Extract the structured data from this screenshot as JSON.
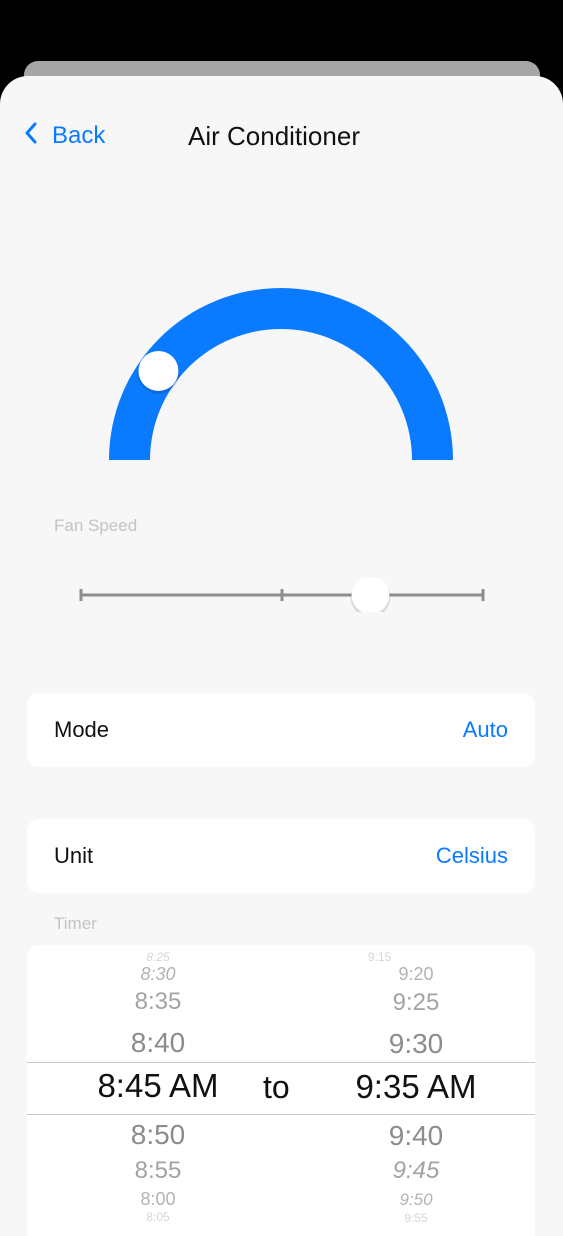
{
  "nav": {
    "back_label": "Back",
    "title": "Air Conditioner"
  },
  "temperature_dial": {
    "accent_color": "#0a7aff",
    "knob_level": 0.2
  },
  "fan_speed": {
    "label": "Fan Speed",
    "steps": 3,
    "value_fraction": 0.72
  },
  "mode": {
    "label": "Mode",
    "value": "Auto"
  },
  "unit": {
    "label": "Unit",
    "value": "Celsius"
  },
  "timer": {
    "label": "Timer",
    "separator": "to",
    "start": {
      "above": [
        "8:25",
        "8:30",
        "8:35",
        "8:40"
      ],
      "selected": "8:45 AM",
      "below": [
        "8:50",
        "8:55",
        "8:00",
        "8:05"
      ]
    },
    "end": {
      "above": [
        "9:15",
        "9:20",
        "9:25",
        "9:30"
      ],
      "selected": "9:35 AM",
      "below": [
        "9:40",
        "9:45",
        "9:50",
        "9:55"
      ]
    }
  },
  "colors": {
    "accent": "#0a7aff",
    "sheet_background": "#f7f7f7",
    "card_background": "#ffffff"
  }
}
